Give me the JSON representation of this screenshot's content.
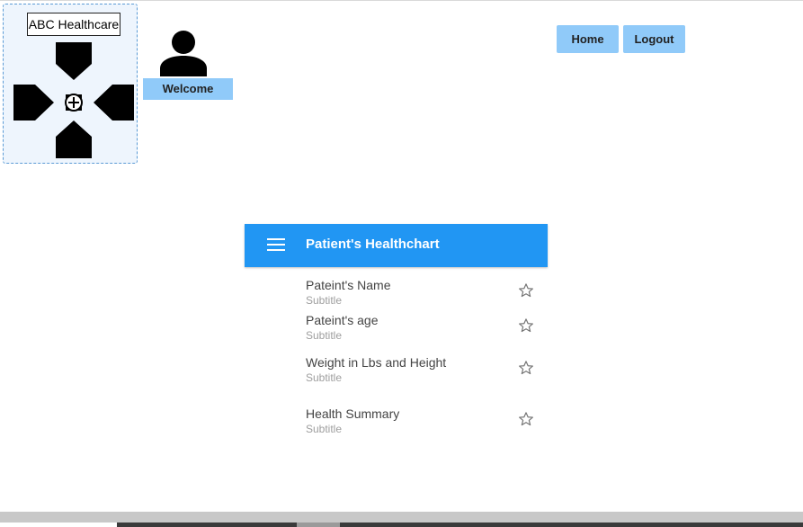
{
  "logo": {
    "title": "ABC Healthcare",
    "icon": "medical-cross-icon"
  },
  "user": {
    "icon": "user-avatar-icon",
    "welcome_label": "Welcome"
  },
  "nav": {
    "home_label": "Home",
    "logout_label": "Logout"
  },
  "healthchart": {
    "title": "Patient's Healthchart",
    "menu_icon": "hamburger-menu-icon",
    "items": [
      {
        "title": "Pateint's Name",
        "subtitle": "Subtitle",
        "icon": "star-outline-icon"
      },
      {
        "title": "Pateint's age",
        "subtitle": "Subtitle",
        "icon": "star-outline-icon"
      },
      {
        "title": "Weight in Lbs and Height",
        "subtitle": "Subtitle",
        "icon": "star-outline-icon"
      },
      {
        "title": "Health Summary",
        "subtitle": "Subtitle",
        "icon": "star-outline-icon"
      }
    ]
  },
  "colors": {
    "header_blue": "#2196f3",
    "button_light_blue": "#90caf9",
    "logo_panel_bg": "#eef5fd"
  }
}
